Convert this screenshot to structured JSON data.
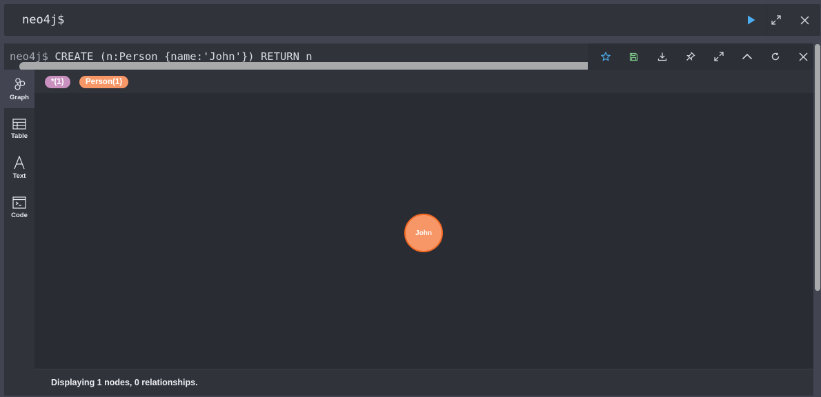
{
  "editor": {
    "prompt": "neo4j$"
  },
  "frame": {
    "query_prompt": "neo4j$",
    "query_text": " CREATE (n:Person {name:'John'}) RETURN n"
  },
  "sidebar": {
    "items": [
      {
        "label": "Graph",
        "icon": "graph-icon"
      },
      {
        "label": "Table",
        "icon": "table-icon"
      },
      {
        "label": "Text",
        "icon": "text-icon"
      },
      {
        "label": "Code",
        "icon": "code-icon"
      }
    ],
    "active": "Graph"
  },
  "legend": {
    "all_nodes": "*(1)",
    "person": "Person(1)"
  },
  "graph": {
    "node_label": "John"
  },
  "footer": {
    "status": "Displaying 1 nodes, 0 relationships."
  },
  "colors": {
    "run_accent": "#4aaef0",
    "all_nodes_pill": "#c990c0",
    "person_node": "#f79767",
    "person_node_border": "#f36924",
    "star_icon": "#4aaef0",
    "save_icon": "#7ec88a"
  }
}
